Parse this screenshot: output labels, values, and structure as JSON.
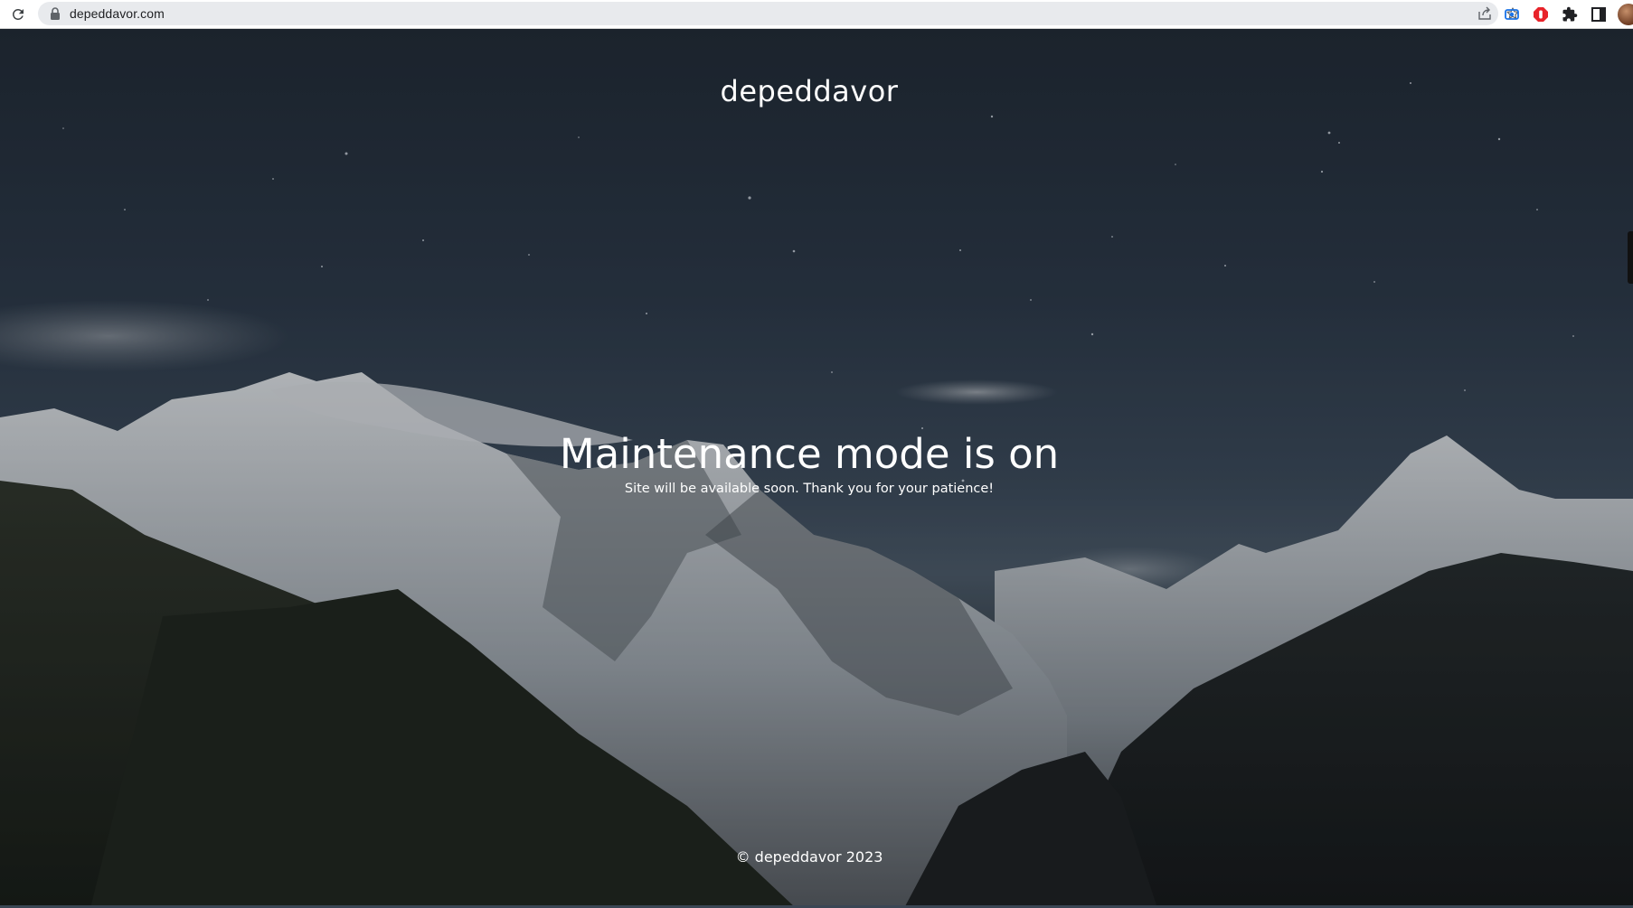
{
  "browser": {
    "url": "depeddavor.com",
    "icons": [
      "reload-icon",
      "lock-icon",
      "share-icon",
      "star-icon",
      "screen-capture-icon",
      "adblock-icon",
      "puzzle-extensions-icon",
      "side-panel-icon",
      "profile-avatar"
    ]
  },
  "page": {
    "site_title": "depeddavor",
    "headline": "Maintenance mode is on",
    "subtext": "Site will be available soon. Thank you for your patience!",
    "footer": "© depeddavor 2023"
  },
  "colors": {
    "sky_top": "#1f2833",
    "sky_mid": "#3a4858",
    "text": "#ffffff",
    "toolbar": "#ffffff",
    "omnibox": "#e8eaed",
    "adblock_red": "#e8232a",
    "capture_blue": "#1a73e8"
  }
}
